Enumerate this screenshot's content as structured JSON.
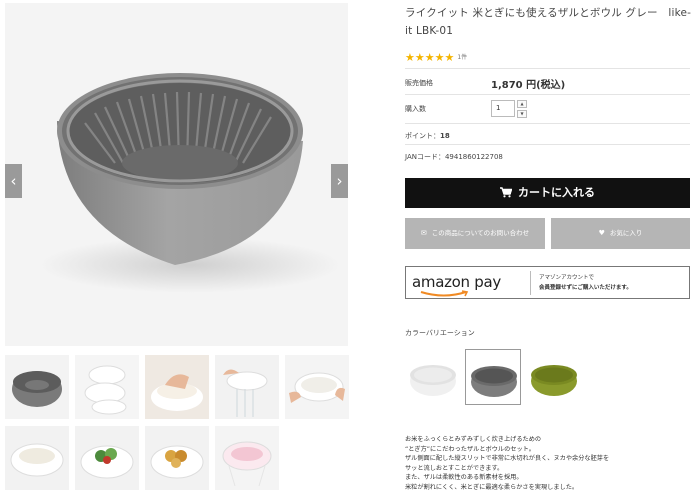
{
  "product": {
    "title": "ライクイット 米とぎにも使えるザルとボウル グレー　like-it LBK-01",
    "rating_stars": "★★★★★",
    "review_count": "1件",
    "price_label": "販売価格",
    "price_value": "1,870 円(税込)",
    "quantity_label": "購入数",
    "quantity_value": "1",
    "qty_up": "▲",
    "qty_down": "▼",
    "points_label": "ポイント：",
    "points_value": "18",
    "jan_text": "JANコード：4941860122708"
  },
  "buttons": {
    "cart": "カートに入れる",
    "inquiry": "この商品についてのお問い合わせ",
    "favorite": "お気に入り"
  },
  "amazon_pay": {
    "logo_word": "amazon",
    "logo_pay": "pay",
    "line1": "アマゾンアカウントで",
    "line2": "会員登録せずにご購入いただけます。"
  },
  "gallery": {
    "prev_arrow": "‹",
    "next_arrow": "›"
  },
  "variation": {
    "label": "カラーバリエーション",
    "swatches": [
      "white",
      "gray",
      "green"
    ]
  },
  "description": [
    "お米をふっくらとみずみずしく炊き上げるための",
    "“とぎ方”にこだわったザルとボウルのセット。",
    "ザル側面に配した縦スリットで非常に水切れが良く、ヌカや余分な胚芽を",
    "サッと流しおとすことができます。",
    "また、ザルは柔軟性のある新素材を採用。",
    "米粒が割れにくく、米とぎに最適な柔らかさを実現しました。"
  ],
  "colors": {
    "cart_bg": "#111111",
    "gray_button": "#b5b5b5",
    "star": "#f4b400",
    "bowl_gray": "#8a8a8a",
    "bowl_green": "#8a9a2c"
  }
}
